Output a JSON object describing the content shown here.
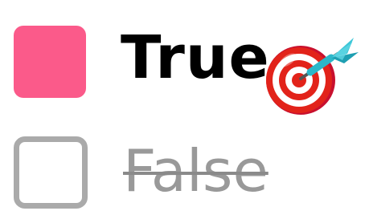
{
  "options": [
    {
      "label": "True",
      "checked": true,
      "icon": "dart-target-icon"
    },
    {
      "label": "False",
      "checked": false,
      "struck_through": true
    }
  ],
  "colors": {
    "checked_fill": "#fb5a8a",
    "unchecked_border": "#aaaaaa",
    "true_text": "#000000",
    "false_text": "#999999"
  }
}
